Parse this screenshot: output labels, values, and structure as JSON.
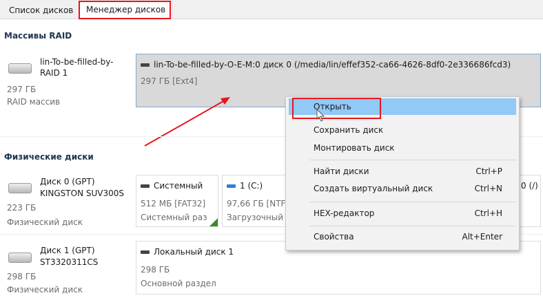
{
  "tabs": [
    {
      "label": "Список дисков"
    },
    {
      "label": "Менеджер дисков"
    }
  ],
  "raid": {
    "title": "Массивы RAID",
    "name1": "lin-To-be-filled-by-",
    "name2": "RAID 1",
    "size": "297 ГБ",
    "type": "RAID массив",
    "partition": {
      "title": "lin-To-be-filled-by-O-E-M:0 диск 0 (/media/lin/effef352-ca66-4626-8df0-2e336686fcd3)",
      "info": "297 ГБ [Ext4]"
    }
  },
  "physical": {
    "title": "Физические диски",
    "disks": [
      {
        "name1": "Диск 0 (GPT)",
        "name2": "KINGSTON SUV300S",
        "size": "223 ГБ",
        "type": "Физический диск",
        "partitions": [
          {
            "title": "Системный",
            "size": "512 МБ [FAT32]",
            "type": "Системный раз"
          },
          {
            "title": "1 (C:)",
            "size": "97,66 ГБ [NTF",
            "type": "Загрузочный"
          },
          {
            "title": "0 (/)"
          }
        ]
      },
      {
        "name1": "Диск 1 (GPT)",
        "name2": "ST3320311CS",
        "size": "298 ГБ",
        "type": "Физический диск",
        "partitions": [
          {
            "title": "Локальный диск 1",
            "size": "298 ГБ",
            "type": "Основной раздел"
          }
        ]
      }
    ]
  },
  "menu": {
    "items": [
      {
        "label": "Открыть"
      },
      {
        "label": "Сохранить диск"
      },
      {
        "label": "Монтировать диск"
      },
      {
        "label": "Найти диски",
        "shortcut": "Ctrl+P"
      },
      {
        "label": "Создать виртуальный диск",
        "shortcut": "Ctrl+N"
      },
      {
        "label": "HEX-редактор",
        "shortcut": "Ctrl+H"
      },
      {
        "label": "Свойства",
        "shortcut": "Alt+Enter"
      }
    ]
  },
  "colors": {
    "highlight": "#91c9f7",
    "annotation": "#e8141b",
    "selected": "#d9d9d9"
  }
}
